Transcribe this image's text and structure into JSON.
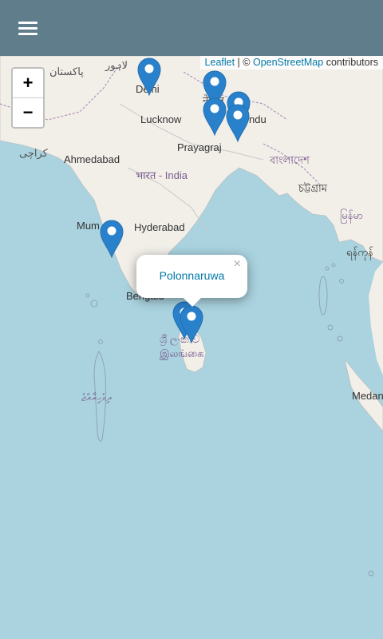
{
  "app": {
    "menu_icon": "hamburger-menu-icon"
  },
  "map": {
    "attribution": {
      "leaflet": "Leaflet",
      "separator": " | © ",
      "osm": "OpenStreetMap",
      "suffix": " contributors"
    },
    "zoom": {
      "in": "+",
      "out": "−"
    },
    "labels": {
      "pakistan": "پاکستان",
      "lahore": "لاہور",
      "delhi": "Delhi",
      "nepal": "नेपाल",
      "lucknow": "Lucknow",
      "kathmandu": "ndu",
      "karachi": "کراچی",
      "ahmedabad": "Ahmedabad",
      "prayagraj": "Prayagraj",
      "india": "भारत - India",
      "bangladesh": "বাংলাদেশ",
      "chittagong": "চট্টগ্রাম",
      "myanmar": "မြန်မာ",
      "mumbai": "Mum",
      "hyderabad": "Hyderabad",
      "myanmar2": "ရန်ကုန်",
      "bengaluru": "Bengalu",
      "srilanka_si": "ශ්‍රී ලංකාව",
      "srilanka_ta": "இலங்கை",
      "maldives": "ދިވެހިރާއްޖެ",
      "medan": "Medan"
    },
    "popup": {
      "text": "Polonnaruwa",
      "close": "×"
    },
    "colors": {
      "marker": "#2a81cb",
      "water": "#aad3df",
      "land": "#f2efe9"
    }
  }
}
